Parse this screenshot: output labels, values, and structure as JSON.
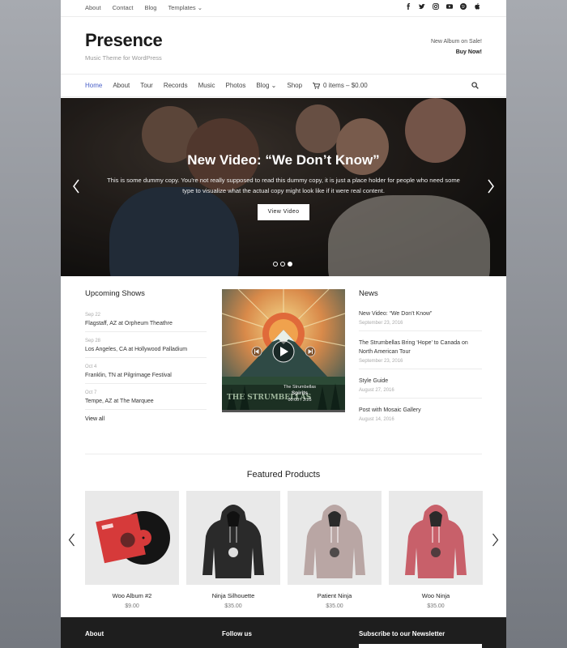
{
  "topbar": {
    "links": [
      "About",
      "Contact",
      "Blog",
      "Templates"
    ],
    "social": [
      "facebook-icon",
      "twitter-icon",
      "instagram-icon",
      "youtube-icon",
      "spotify-icon",
      "apple-icon"
    ]
  },
  "header": {
    "title": "Presence",
    "tagline": "Music Theme for WordPress",
    "promo_line1": "New Album on Sale!",
    "promo_line2": "Buy Now!"
  },
  "nav": {
    "items": [
      "Home",
      "About",
      "Tour",
      "Records",
      "Music",
      "Photos",
      "Blog",
      "Shop"
    ],
    "active": "Home",
    "cart": "0 items – $0.00"
  },
  "hero": {
    "title": "New Video: “We Don’t Know”",
    "copy": "This is some dummy copy. You’re not really supposed to read this dummy copy, it is just a place holder for people who need some type to visualize what the actual copy might look like if it were real content.",
    "button": "View Video",
    "slides": 3,
    "active_slide": 3
  },
  "shows": {
    "title": "Upcoming Shows",
    "items": [
      {
        "date": "Sep 22",
        "venue": "Flagstaff, AZ at Orpheum Theathre"
      },
      {
        "date": "Sep 28",
        "venue": "Los Angeles, CA at Hollywood Palladium"
      },
      {
        "date": "Oct 4",
        "venue": "Franklin, TN at Pilgrimage Festival"
      },
      {
        "date": "Oct 7",
        "venue": "Tempe, AZ at The Marquee"
      }
    ],
    "view_all": "View all"
  },
  "player": {
    "artist": "The Strumbellas",
    "track": "Spirits",
    "time": "00:00 / 3:25",
    "cover_text": "THE STRUMBELLAS"
  },
  "news": {
    "title": "News",
    "items": [
      {
        "title": "New Video: “We Don’t Know”",
        "date": "September 23, 2016"
      },
      {
        "title": "The Strumbellas Bring ‘Hope’ to Canada on North American Tour",
        "date": "September 23, 2016"
      },
      {
        "title": "Style Guide",
        "date": "August 27, 2016"
      },
      {
        "title": "Post with Mosaic Gallery",
        "date": "August 14, 2016"
      }
    ]
  },
  "featured": {
    "title": "Featured Products",
    "products": [
      {
        "name": "Woo Album #2",
        "price": "$9.00",
        "color": "#d63a3a"
      },
      {
        "name": "Ninja Silhouette",
        "price": "$35.00",
        "color": "#2a2a2a"
      },
      {
        "name": "Patient Ninja",
        "price": "$35.00",
        "color": "#b9a6a4"
      },
      {
        "name": "Woo Ninja",
        "price": "$35.00",
        "color": "#c8606a"
      }
    ]
  },
  "footer": {
    "about": "About",
    "follow": "Follow us",
    "newsletter": "Subscribe to our Newsletter"
  }
}
